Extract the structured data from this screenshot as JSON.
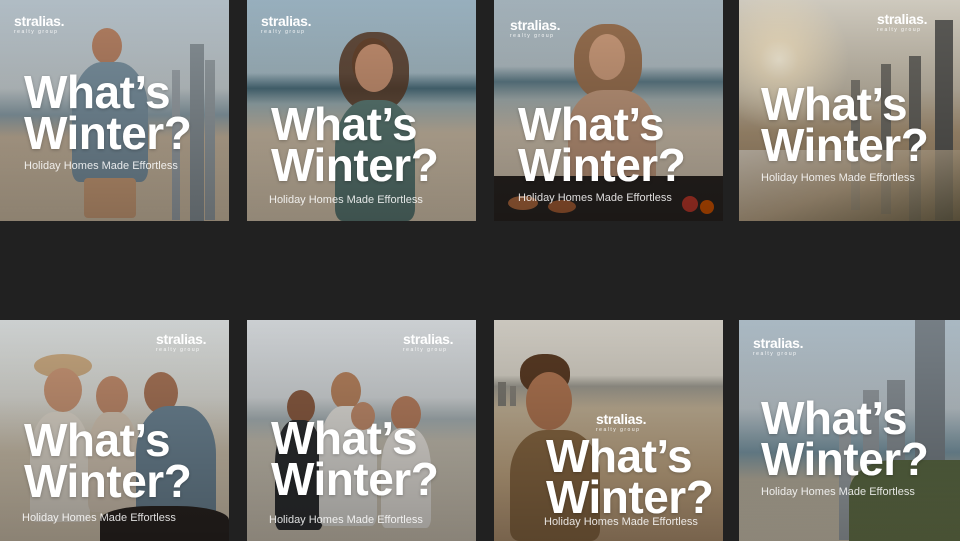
{
  "brand": {
    "name": "stralias.",
    "tagline_small": "realty group"
  },
  "tiles": [
    {
      "headline_1": "What’s",
      "headline_2": "Winter?",
      "tagline": "Holiday Homes Made Effortless",
      "scene": "man-on-beach-city-skyline"
    },
    {
      "headline_1": "What’s",
      "headline_2": "Winter?",
      "tagline": "Holiday Homes Made Effortless",
      "scene": "woman-laughing-beach"
    },
    {
      "headline_1": "What’s",
      "headline_2": "Winter?",
      "tagline": "Holiday Homes Made Effortless",
      "scene": "woman-at-beach-bbq"
    },
    {
      "headline_1": "What’s",
      "headline_2": "Winter?",
      "tagline": "Holiday Homes Made Effortless",
      "scene": "sunset-beach-city-skyline"
    },
    {
      "headline_1": "What’s",
      "headline_2": "Winter?",
      "tagline": "Holiday Homes Made Effortless",
      "scene": "friends-beach-bbq"
    },
    {
      "headline_1": "What’s",
      "headline_2": "Winter?",
      "tagline": "Holiday Homes Made Effortless",
      "scene": "family-on-beach"
    },
    {
      "headline_1": "What’s",
      "headline_2": "Winter?",
      "tagline": "Holiday Homes Made Effortless",
      "scene": "man-smiling-beach-skyline"
    },
    {
      "headline_1": "What’s",
      "headline_2": "Winter?",
      "tagline": "Holiday Homes Made Effortless",
      "scene": "aerial-beach-towers"
    }
  ],
  "colors": {
    "background": "#212121",
    "text": "#ffffff"
  }
}
